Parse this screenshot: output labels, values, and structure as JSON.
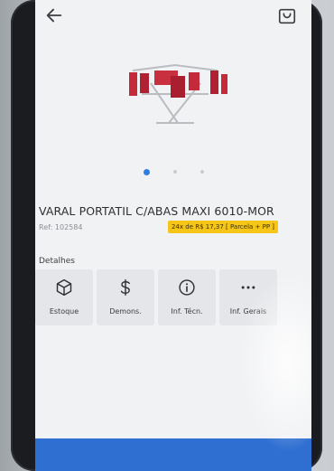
{
  "icons": {
    "back": "arrow-left-icon",
    "bag": "shopping-bag-icon",
    "estoque": "box-icon",
    "demons": "dollar-icon",
    "inf_tecn": "info-icon",
    "inf_gerais": "more-icon"
  },
  "carousel": {
    "pages": 3,
    "active": 0
  },
  "product": {
    "title": "VARAL PORTATIL C/ABAS MAXI 6010-MOR",
    "ref": "Ref: 102584",
    "price_badge": "24x de R$ 17,37 [ Parcela + PP ]"
  },
  "details": {
    "label": "Detalhes",
    "cards": [
      {
        "label": "Estoque"
      },
      {
        "label": "Demons."
      },
      {
        "label": "Inf. Técn."
      },
      {
        "label": "Inf. Gerais"
      }
    ]
  },
  "colors": {
    "accent": "#2f7de1",
    "badge": "#f5c518",
    "bottom_bar": "#2f6fd1"
  }
}
